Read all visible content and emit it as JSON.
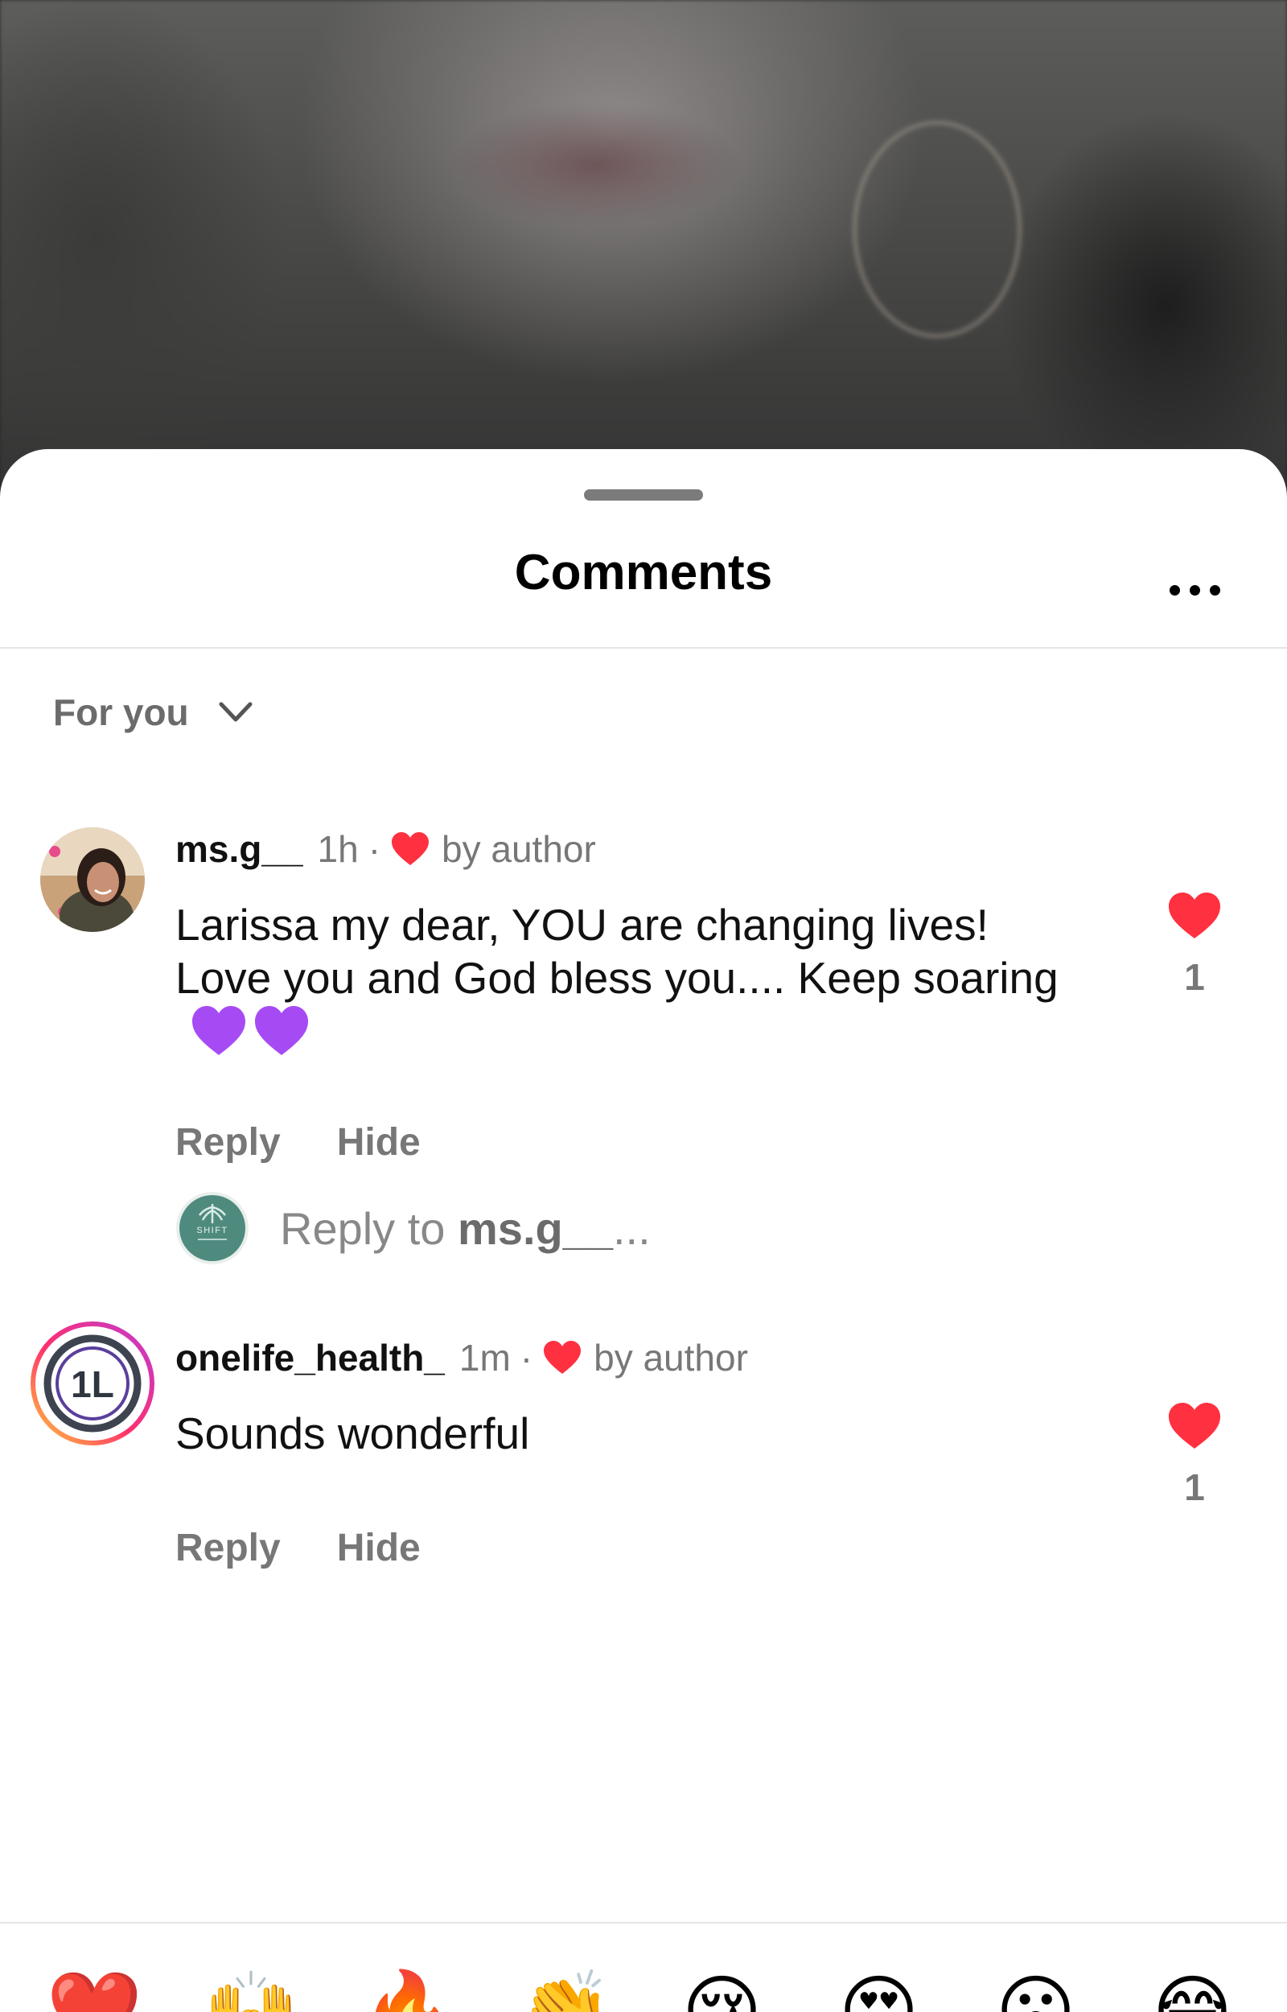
{
  "sheet": {
    "title": "Comments",
    "sort_label": "For you"
  },
  "comments": [
    {
      "username": "ms.g__",
      "time": "1h",
      "separator": "·",
      "liked_by": "by author",
      "text": "Larissa my dear, YOU are changing lives! Love you and God bless you.... Keep soaring",
      "emoji": "💜💜",
      "reply_label": "Reply",
      "hide_label": "Hide",
      "like_count": "1"
    },
    {
      "username": "onelife_health_",
      "time": "1m",
      "separator": "·",
      "liked_by": "by author",
      "text": "Sounds wonderful",
      "reply_label": "Reply",
      "hide_label": "Hide",
      "like_count": "1"
    }
  ],
  "reply_box": {
    "prefix": "Reply to ",
    "target": "ms.g__",
    "suffix": "..."
  },
  "avatars": {
    "shift_logo_text": "SHIFT",
    "onelife_logo_text": "1L"
  },
  "emoji_bar": [
    "❤️",
    "🙌",
    "🔥",
    "👏",
    "😢",
    "😍",
    "😮",
    "😂"
  ],
  "colors": {
    "like_red": "#ff3040",
    "purple_heart": "#a64bf4",
    "muted_text": "#777777"
  }
}
